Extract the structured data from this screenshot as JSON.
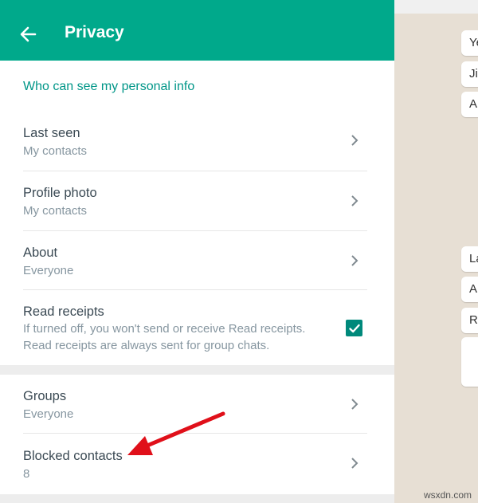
{
  "header": {
    "title": "Privacy"
  },
  "section": {
    "title": "Who can see my personal info"
  },
  "rows": [
    {
      "label": "Last seen",
      "value": "My contacts"
    },
    {
      "label": "Profile photo",
      "value": "My contacts"
    },
    {
      "label": "About",
      "value": "Everyone"
    }
  ],
  "read_receipts": {
    "label": "Read receipts",
    "description": "If turned off, you won't send or receive Read receipts. Read receipts are always sent for group chats.",
    "checked": true
  },
  "groups": {
    "label": "Groups",
    "value": "Everyone"
  },
  "blocked": {
    "label": "Blocked contacts",
    "value": "8"
  },
  "chat_preview": {
    "bubbles": [
      "Ye",
      "Ji",
      "A",
      "La",
      "A",
      "Re"
    ]
  },
  "watermark": "wsxdn.com",
  "colors": {
    "accent": "#00a98b",
    "check": "#00897b",
    "annotation_arrow": "#e0101a"
  }
}
